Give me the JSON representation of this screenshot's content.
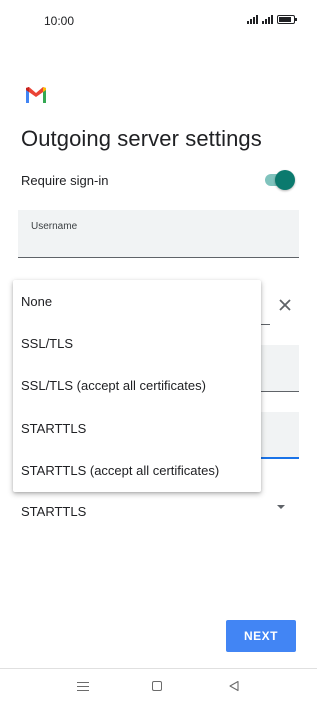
{
  "status_bar": {
    "time": "10:00"
  },
  "app": {
    "logo_icon": "gmail-logo-icon"
  },
  "page": {
    "title": "Outgoing server settings"
  },
  "settings": {
    "require_signin_label": "Require sign-in",
    "require_signin_enabled": true,
    "username_label": "Username",
    "security_type_value": "STARTTLS"
  },
  "security_menu": {
    "options": [
      "None",
      "SSL/TLS",
      "SSL/TLS (accept all certificates)",
      "STARTTLS",
      "STARTTLS (accept all certificates)"
    ]
  },
  "actions": {
    "next_label": "NEXT"
  },
  "colors": {
    "accent": "#4285f4",
    "switch_on": "#0b7a6e",
    "focus": "#1a73e8"
  }
}
